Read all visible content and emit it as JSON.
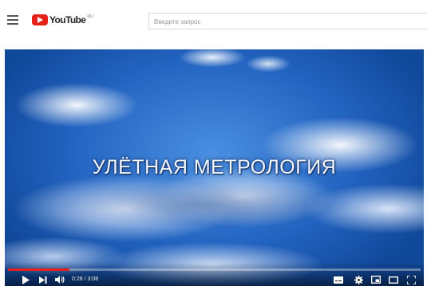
{
  "header": {
    "logo_text": "YouTube",
    "logo_region": "RU",
    "search_placeholder": "Введите запрос"
  },
  "player": {
    "video_title": "УЛЁТНАЯ МЕТРОЛОГИЯ",
    "time_display": "0:28 / 3:08",
    "progress_fraction": 0.149
  },
  "colors": {
    "brand_red": "#e62117",
    "sky_blue": "#2263c0"
  },
  "icons": {
    "menu": "hamburger-menu-icon",
    "play": "play-icon",
    "next": "next-icon",
    "volume": "volume-icon",
    "subtitles": "subtitles-icon",
    "settings": "gear-icon",
    "miniplayer": "miniplayer-icon",
    "theater": "theater-icon",
    "fullscreen": "fullscreen-icon"
  }
}
